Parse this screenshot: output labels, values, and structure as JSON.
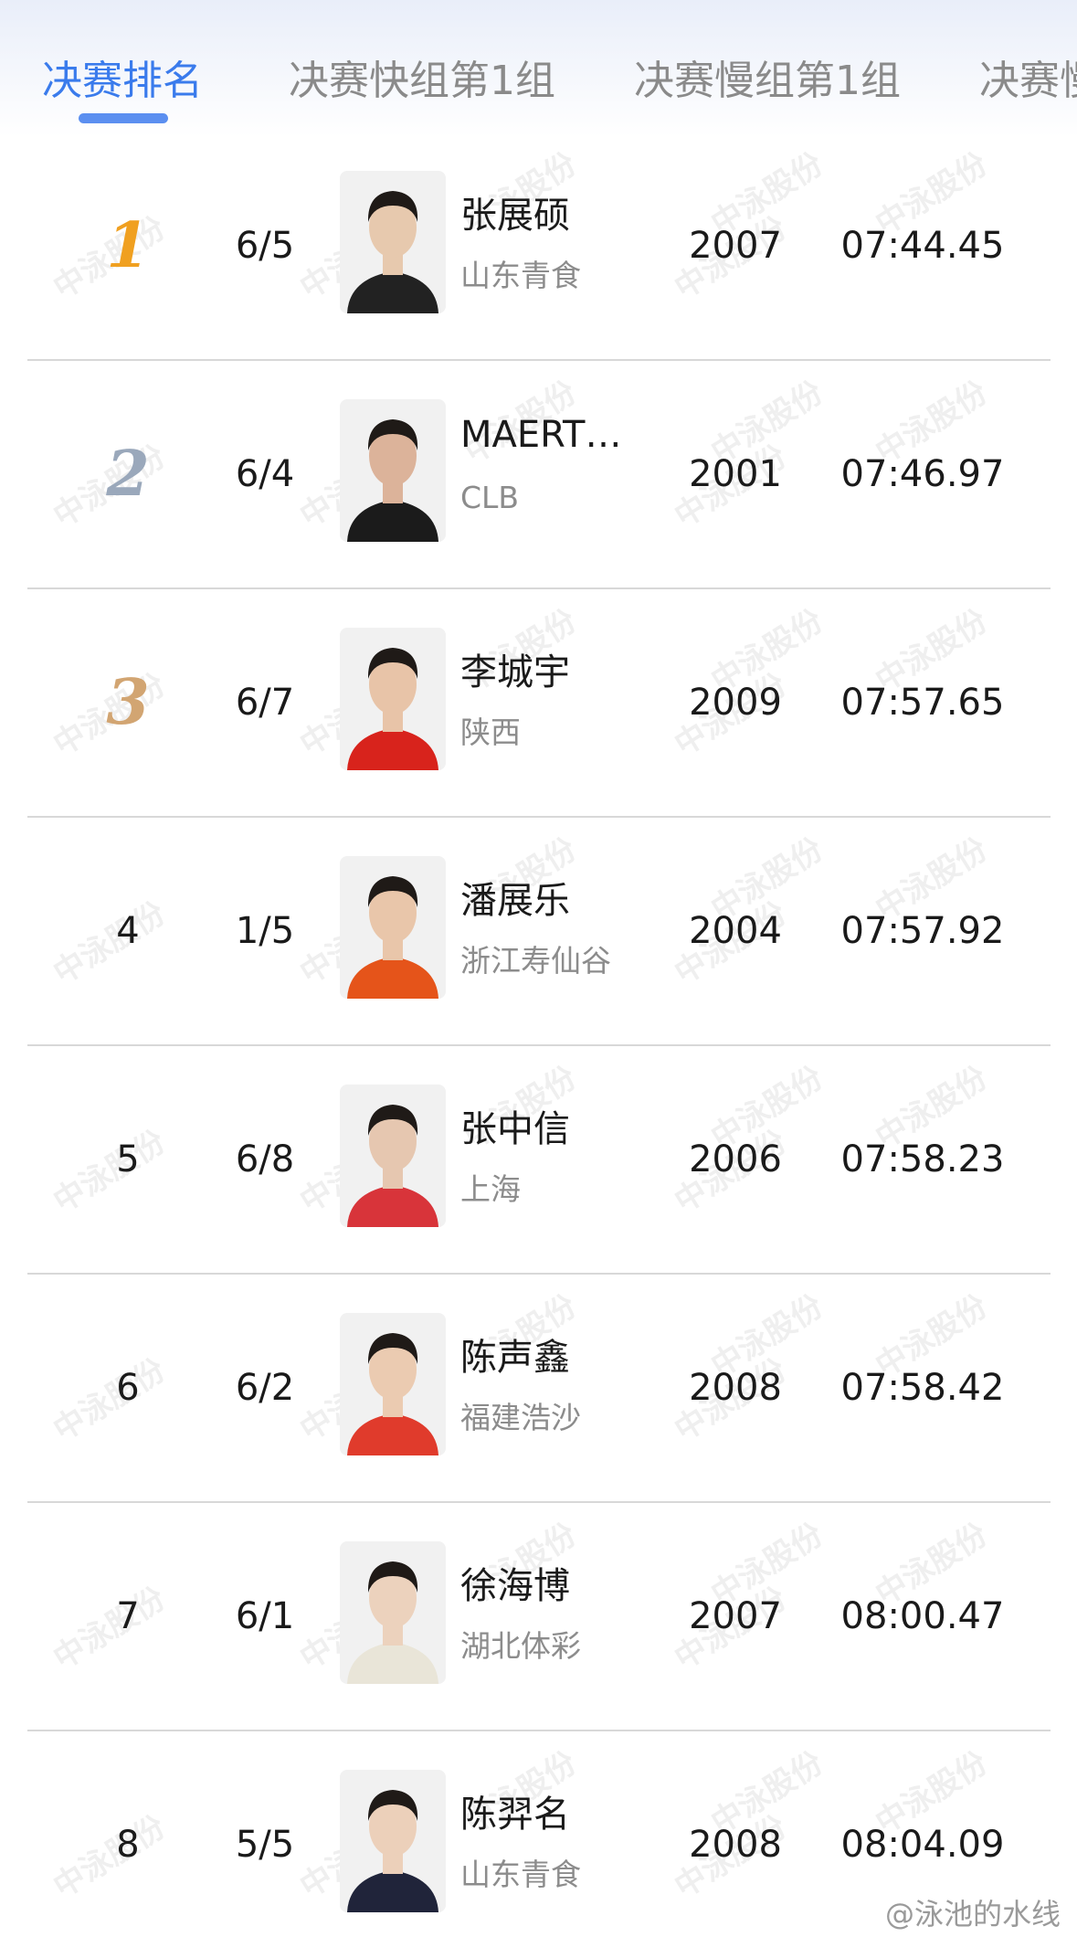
{
  "tabs": [
    {
      "label": "决赛排名"
    },
    {
      "label": "决赛快组第1组"
    },
    {
      "label": "决赛慢组第1组"
    },
    {
      "label": "决赛慢"
    }
  ],
  "colors": {
    "accent": "#3a7bec",
    "gold": "#f0a020",
    "silver": "#9aa8bb",
    "bronze": "#d2a572"
  },
  "rows": [
    {
      "rank": "1",
      "lane": "6/5",
      "name": "张展硕",
      "team": "山东青食",
      "year": "2007",
      "time": "07:44.45",
      "photo_top": "#e7c9ae",
      "photo_bottom": "#222222"
    },
    {
      "rank": "2",
      "lane": "6/4",
      "name": "MAERT…",
      "team": "CLB",
      "year": "2001",
      "time": "07:46.97",
      "photo_top": "#dcb39a",
      "photo_bottom": "#1b1b1b"
    },
    {
      "rank": "3",
      "lane": "6/7",
      "name": "李城宇",
      "team": "陕西",
      "year": "2009",
      "time": "07:57.65",
      "photo_top": "#e8c4a8",
      "photo_bottom": "#d8231c"
    },
    {
      "rank": "4",
      "lane": "1/5",
      "name": "潘展乐",
      "team": "浙江寿仙谷",
      "year": "2004",
      "time": "07:57.92",
      "photo_top": "#e9c6aa",
      "photo_bottom": "#e5541a"
    },
    {
      "rank": "5",
      "lane": "6/8",
      "name": "张中信",
      "team": "上海",
      "year": "2006",
      "time": "07:58.23",
      "photo_top": "#e6c7b0",
      "photo_bottom": "#d8343a"
    },
    {
      "rank": "6",
      "lane": "6/2",
      "name": "陈声鑫",
      "team": "福建浩沙",
      "year": "2008",
      "time": "07:58.42",
      "photo_top": "#ebcbb1",
      "photo_bottom": "#e03b2c"
    },
    {
      "rank": "7",
      "lane": "6/1",
      "name": "徐海博",
      "team": "湖北体彩",
      "year": "2007",
      "time": "08:00.47",
      "photo_top": "#ecd2bd",
      "photo_bottom": "#e9e5d8"
    },
    {
      "rank": "8",
      "lane": "5/5",
      "name": "陈羿名",
      "team": "山东青食",
      "year": "2008",
      "time": "08:04.09",
      "photo_top": "#ecd0ba",
      "photo_bottom": "#20243a"
    }
  ],
  "watermark": {
    "text": "中泳股份"
  },
  "footer": {
    "text": "@泳池的水线"
  }
}
